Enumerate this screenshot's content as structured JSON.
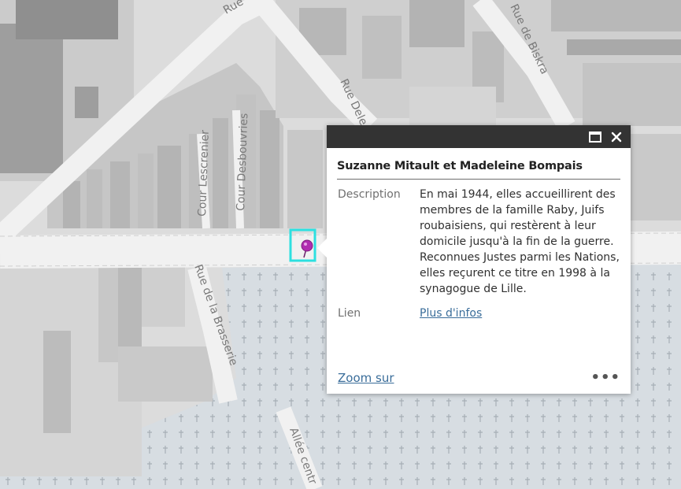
{
  "map": {
    "streets": {
      "rue_top": "Rue",
      "rue_de_biskra": "Rue de Biskra",
      "rue_dele": "Rue Dele",
      "cour_lescrenier": "Cour Lescrenier",
      "cour_desbouvries": "Cour Desbouvries",
      "rue_de_la_brasserie": "Rue de la Brasserie",
      "allee_centr": "Allée centr"
    },
    "marker_icon": "location-pin-icon",
    "colors": {
      "background": "#dedede",
      "building_light": "#d2d2d2",
      "building_dark": "#b5b5b5",
      "road": "#f1f1f1",
      "cemetery": "#d7dde2",
      "cemetery_cross": "#a6aeb5",
      "marker": "#b02db0",
      "selection": "#2de0e0"
    }
  },
  "popup": {
    "title": "Suzanne Mitault et Madeleine Bompais",
    "maximize_icon": "maximize-icon",
    "close_icon": "close-icon",
    "fields": [
      {
        "label": "Description",
        "value": "En mai 1944, elles accueillirent des membres de la famille Raby, Juifs roubaisiens, qui restèrent à leur domicile jusqu'à la fin de la guerre. Reconnues Justes parmi les Nations, elles reçurent ce titre en 1998 à la synagogue de Lille."
      },
      {
        "label": "Lien",
        "value": "Plus d'infos"
      }
    ],
    "zoom_label": "Zoom sur",
    "more_label": "•••",
    "header_color": "#333333",
    "link_color": "#3a6d9a"
  }
}
